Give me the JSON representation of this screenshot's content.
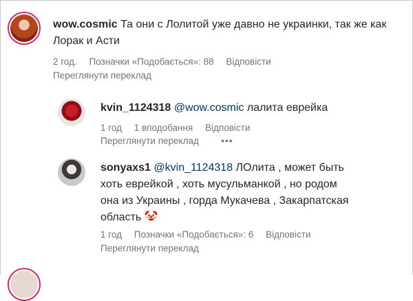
{
  "comments": [
    {
      "username": "wow.cosmic",
      "text": "Та они с Лолитой уже давно не украинки, так же как Лорак и Асти",
      "time": "2 год.",
      "likes": "Позначки «Подобається»: 88",
      "reply": "Відповісти",
      "translate": "Переглянути переклад"
    },
    {
      "username": "kvin_1124318",
      "mention": "@wow.cosmic",
      "text": "лалита еврейка",
      "time": "1 год",
      "likes": "1 вподобання",
      "reply": "Відповісти",
      "translate": "Переглянути переклад",
      "more": "•••"
    },
    {
      "username": "sonyaxs1",
      "mention": "@kvin_1124318",
      "text_line1": "ЛОлита , может быть",
      "text_line2": "хоть еврейкой , хоть мусульманкой , но родом",
      "text_line3": "она из Украины , горда Мукачева , Закарпатская",
      "text_line4": "область",
      "emoji": "🤡",
      "time": "1 год",
      "likes": "Позначки «Подобається»: 6",
      "reply": "Відповісти",
      "translate": "Переглянути переклад"
    }
  ],
  "colors": {
    "accent_ring": "#d62976",
    "mention": "#00376b",
    "meta": "#737373"
  }
}
